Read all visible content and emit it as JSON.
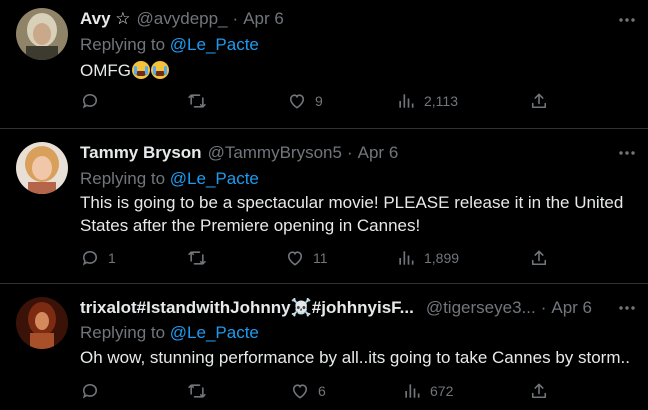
{
  "tweets": [
    {
      "name": "Avy ☆",
      "handle": "@avydepp_",
      "dot": "·",
      "date": "Apr 6",
      "reply_prefix": "Replying to",
      "reply_to": "@Le_Pacte",
      "text": "OMFG",
      "emoji": "loudly-crying-face",
      "counts": {
        "reply": "",
        "retweet": "",
        "like": "9",
        "views": "2,113"
      }
    },
    {
      "name": "Tammy Bryson",
      "handle": "@TammyBryson5",
      "dot": "·",
      "date": "Apr 6",
      "reply_prefix": "Replying to",
      "reply_to": "@Le_Pacte",
      "text": "This is going to be a spectacular movie!  PLEASE release it in the United States after the Premiere opening in Cannes!",
      "counts": {
        "reply": "1",
        "retweet": "",
        "like": "11",
        "views": "1,899"
      }
    },
    {
      "name": "trixalot#IstandwithJohnny☠️#johhnyisF...",
      "handle": "@tigerseye3...",
      "dot": "·",
      "date": "Apr 6",
      "reply_prefix": "Replying to",
      "reply_to": "@Le_Pacte",
      "text": "Oh wow, stunning performance by all..its going to take  Cannes by storm..",
      "counts": {
        "reply": "",
        "retweet": "",
        "like": "6",
        "views": "672"
      }
    }
  ],
  "colors": {
    "accent": "#1d9bf0",
    "muted": "#71767b",
    "text": "#e7e9ea",
    "divider": "#2f3336",
    "background": "#000000"
  },
  "icons": [
    "more-icon",
    "reply-icon",
    "retweet-icon",
    "like-icon",
    "views-icon",
    "share-icon"
  ]
}
